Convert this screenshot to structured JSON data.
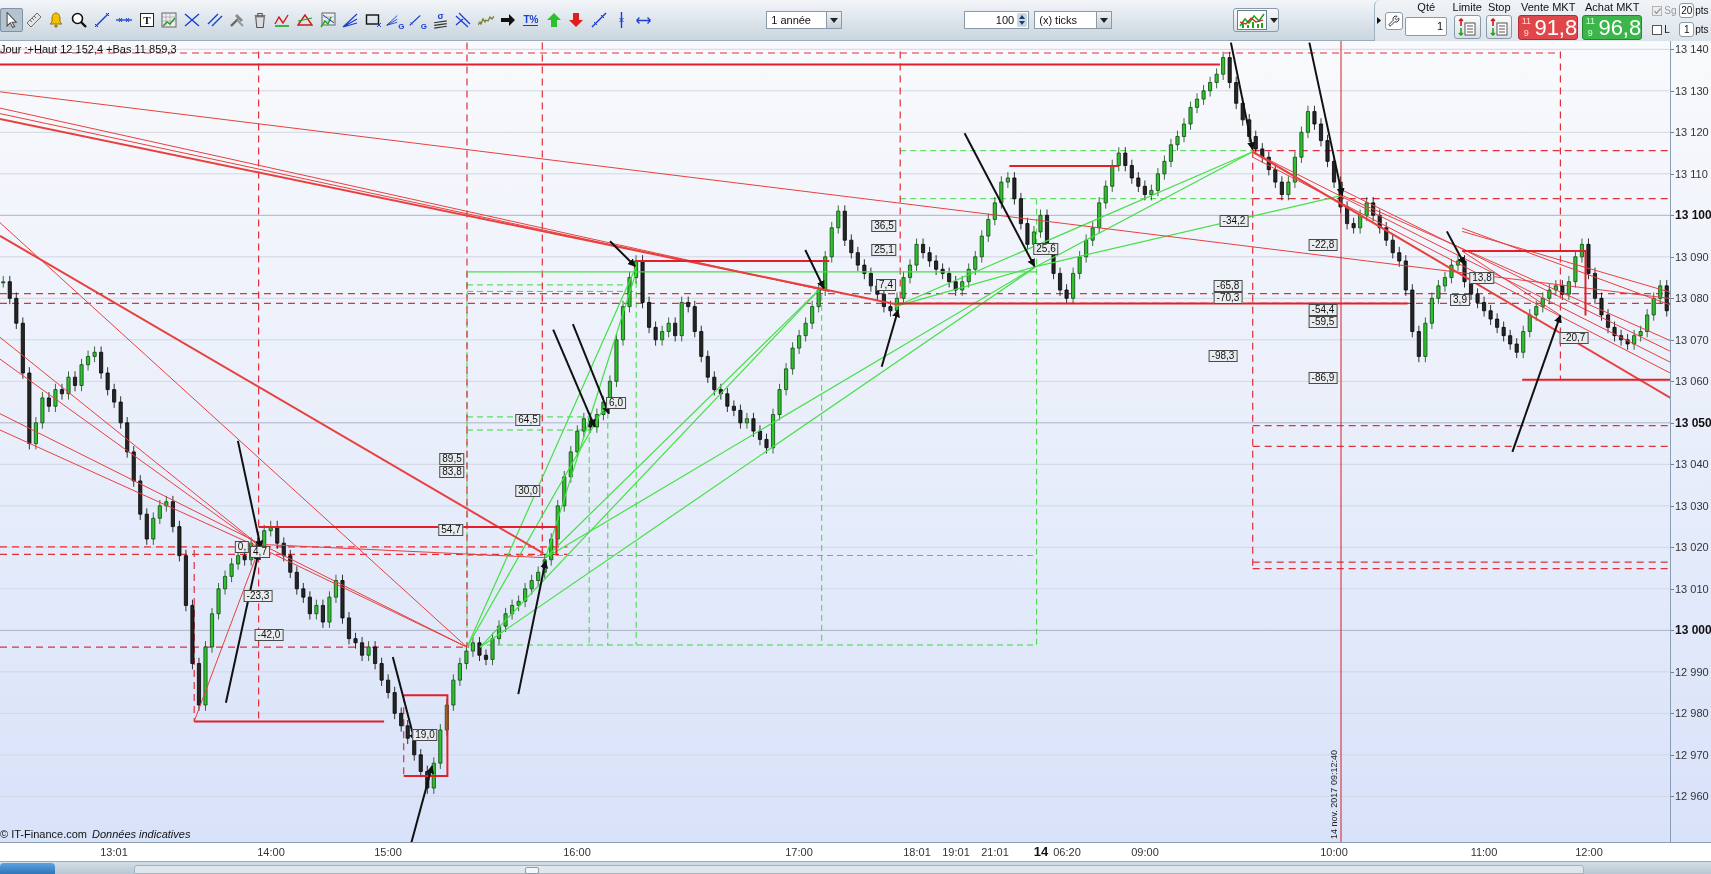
{
  "toolbar": {
    "tools": [
      {
        "kind": "pointer",
        "selected": true
      },
      {
        "kind": "ruler",
        "selected": false
      },
      {
        "kind": "alert",
        "selected": false
      },
      {
        "kind": "zoom",
        "selected": false
      },
      {
        "kind": "segment",
        "selected": false
      },
      {
        "kind": "horizontal",
        "selected": false
      },
      {
        "kind": "text",
        "glyph": "T",
        "selected": false
      },
      {
        "kind": "grid",
        "selected": false
      },
      {
        "kind": "cross",
        "selected": false
      },
      {
        "kind": "parallel",
        "selected": false
      },
      {
        "kind": "tools",
        "selected": false
      },
      {
        "kind": "trash",
        "selected": false
      },
      {
        "kind": "wave",
        "selected": false
      },
      {
        "kind": "triangle",
        "selected": false
      },
      {
        "kind": "pattern",
        "selected": false
      },
      {
        "kind": "fan",
        "selected": false
      },
      {
        "kind": "rectangle",
        "selected": false
      },
      {
        "kind": "fan",
        "glyph": "G",
        "selected": false
      },
      {
        "kind": "ray",
        "glyph": "G",
        "selected": false
      },
      {
        "kind": "sigma",
        "glyph": "σ",
        "selected": false
      },
      {
        "kind": "channel",
        "selected": false
      },
      {
        "kind": "zigzag",
        "selected": false
      },
      {
        "kind": "arrow",
        "selected": false
      },
      {
        "kind": "percent",
        "glyph": "T%",
        "selected": false
      },
      {
        "kind": "up",
        "selected": false
      },
      {
        "kind": "down",
        "selected": false
      },
      {
        "kind": "trendline",
        "selected": false
      },
      {
        "kind": "vertical",
        "selected": false
      },
      {
        "kind": "span",
        "selected": false
      }
    ],
    "period": {
      "value": "1 année"
    },
    "ticks": {
      "value": "100",
      "unit": "(x) ticks"
    }
  },
  "order_panel": {
    "quantity": {
      "label": "Qté",
      "value": "1"
    },
    "limit": {
      "label": "Limite"
    },
    "stop": {
      "label": "Stop"
    },
    "sell": {
      "label": "Vente MKT",
      "prefix": "11 9",
      "price": "91,8"
    },
    "buy": {
      "label": "Achat MKT",
      "prefix": "11 9",
      "price": "96,8"
    },
    "options": [
      {
        "label": "Sg",
        "checked": true,
        "disabled": true,
        "points": "20",
        "unit": "pts"
      },
      {
        "label": "L",
        "checked": false,
        "disabled": false,
        "points": "1",
        "unit": "pts"
      }
    ]
  },
  "chart": {
    "info": "Jour :+Haut 12 152,4 +Bas 11 859,3",
    "value_tags": [
      "36,5",
      "-34,2",
      "25,1",
      "25,6",
      "-22,8",
      "7,4",
      "-65,8",
      "13,8",
      "-70,3",
      "3,9",
      "-54,4",
      "-59,5",
      "-20,7",
      "-98,3",
      "-86,9",
      "6,0",
      "64,5",
      "89,5",
      "83,8",
      "30,0",
      "54,7",
      "0,",
      "4,7",
      "-23,3",
      "-42,0",
      "19,0"
    ],
    "cursor_label": "14 nov. 2017 09:12:40",
    "copyright": "© IT-Finance.com",
    "disclaimer": "Données indicatives"
  },
  "price_axis": {
    "labels": [
      {
        "label": "13 140",
        "kind": "minor"
      },
      {
        "label": "13 130",
        "kind": "minor"
      },
      {
        "label": "13 120",
        "kind": "minor"
      },
      {
        "label": "13 110",
        "kind": "minor"
      },
      {
        "label": "13 100",
        "kind": "major"
      },
      {
        "label": "13 090",
        "kind": "minor"
      },
      {
        "label": "13 080",
        "kind": "minor"
      },
      {
        "label": "13 070",
        "kind": "minor"
      },
      {
        "label": "13 060",
        "kind": "minor"
      },
      {
        "label": "13 050",
        "kind": "major"
      },
      {
        "label": "13 040",
        "kind": "minor"
      },
      {
        "label": "13 030",
        "kind": "minor"
      },
      {
        "label": "13 020",
        "kind": "minor"
      },
      {
        "label": "13 010",
        "kind": "minor"
      },
      {
        "label": "13 000",
        "kind": "major"
      },
      {
        "label": "12 990",
        "kind": "minor"
      },
      {
        "label": "12 980",
        "kind": "minor"
      },
      {
        "label": "12 970",
        "kind": "minor"
      },
      {
        "label": "12 960",
        "kind": "minor"
      }
    ]
  },
  "time_axis": {
    "labels": [
      {
        "label": "13:01",
        "kind": "time"
      },
      {
        "label": "14:00",
        "kind": "time"
      },
      {
        "label": "15:00",
        "kind": "time"
      },
      {
        "label": "16:00",
        "kind": "time"
      },
      {
        "label": "17:00",
        "kind": "time"
      },
      {
        "label": "18:01",
        "kind": "time"
      },
      {
        "label": "19:01",
        "kind": "time"
      },
      {
        "label": "21:01",
        "kind": "time"
      },
      {
        "label": "14",
        "kind": "day"
      },
      {
        "label": "06:20",
        "kind": "time"
      },
      {
        "label": "09:00",
        "kind": "time"
      },
      {
        "label": "10:00",
        "kind": "time"
      },
      {
        "label": "11:00",
        "kind": "time"
      },
      {
        "label": "12:00",
        "kind": "time"
      }
    ]
  }
}
